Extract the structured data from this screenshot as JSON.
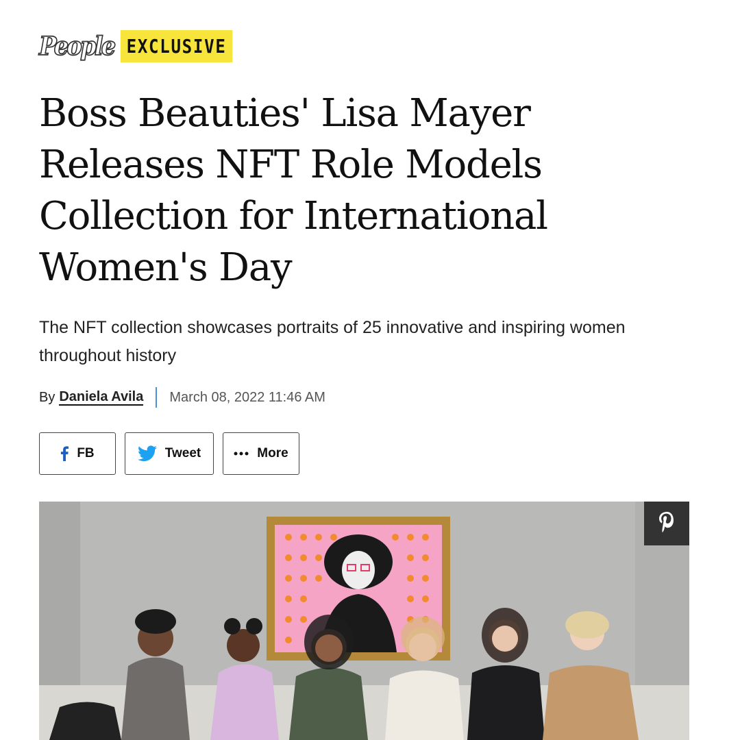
{
  "brand": {
    "logo_text": "People",
    "badge": "EXCLUSIVE"
  },
  "article": {
    "title": "Boss Beauties' Lisa Mayer Releases NFT Role Models Collection for International Women's Day",
    "subtitle": "The NFT collection showcases portraits of 25 innovative and inspiring women throughout history",
    "byline_prefix": "By",
    "author": "Daniela Avila",
    "date": "March 08, 2022 11:46 AM"
  },
  "share": {
    "fb_label": "FB",
    "tweet_label": "Tweet",
    "more_label": "More"
  },
  "photo": {
    "pin_icon": "pinterest-icon"
  },
  "colors": {
    "badge_bg": "#f7e53b",
    "separator": "#4a90d9",
    "twitter": "#1da1f2",
    "pin_bg": "#333333"
  }
}
